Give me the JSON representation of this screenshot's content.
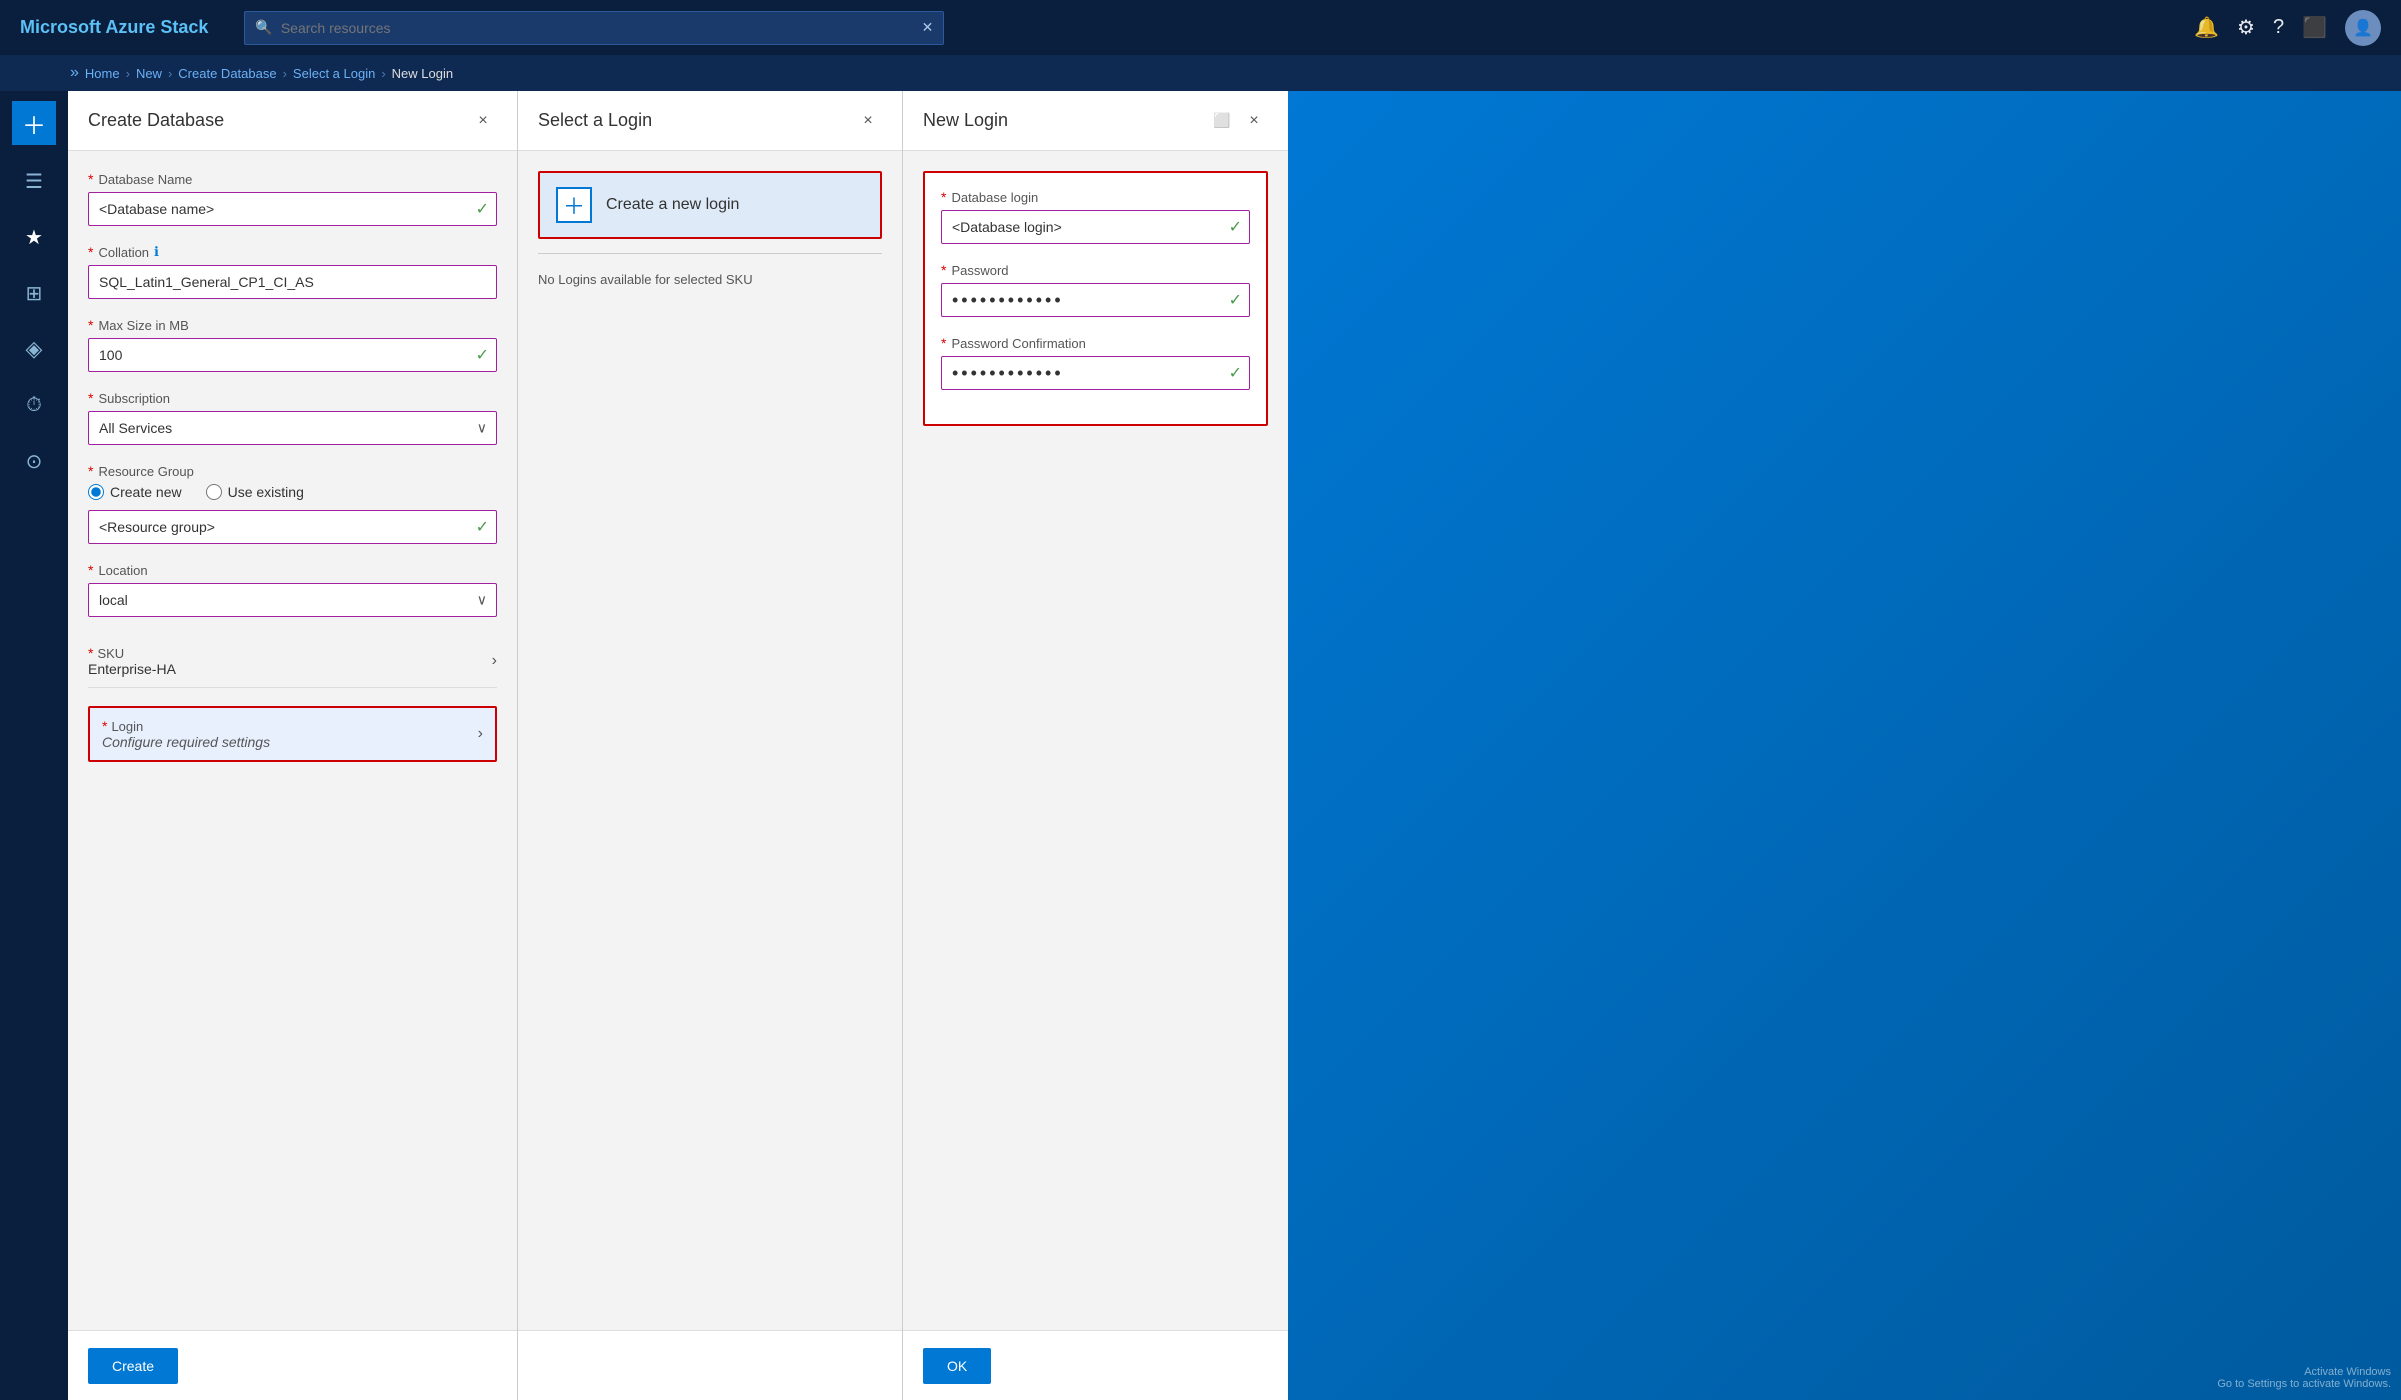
{
  "app": {
    "title": "Microsoft Azure Stack"
  },
  "topbar": {
    "title": "Microsoft Azure Stack",
    "search_placeholder": "Search resources",
    "close_icon": "✕"
  },
  "breadcrumb": {
    "items": [
      "Home",
      "New",
      "Create Database",
      "Select a Login",
      "New Login"
    ],
    "separator": "›"
  },
  "sidebar": {
    "items": [
      {
        "label": "+",
        "icon": "＋",
        "id": "plus"
      },
      {
        "label": "Menu",
        "icon": "☰",
        "id": "menu"
      },
      {
        "label": "Favorites",
        "icon": "★",
        "id": "favorites"
      },
      {
        "label": "Dashboard",
        "icon": "⊞",
        "id": "dashboard"
      },
      {
        "label": "Resources",
        "icon": "⬡",
        "id": "resources"
      },
      {
        "label": "History",
        "icon": "⏱",
        "id": "history"
      },
      {
        "label": "Notifications",
        "icon": "⊙",
        "id": "notifications"
      }
    ]
  },
  "create_database_panel": {
    "title": "Create Database",
    "close_label": "×",
    "fields": {
      "database_name": {
        "label": "Database Name",
        "value": "<Database name>",
        "placeholder": "<Database name>"
      },
      "collation": {
        "label": "Collation",
        "value": "SQL_Latin1_General_CP1_CI_AS"
      },
      "max_size_mb": {
        "label": "Max Size in MB",
        "value": "100"
      },
      "subscription": {
        "label": "Subscription",
        "value": "All Services",
        "options": [
          "All Services"
        ]
      },
      "resource_group": {
        "label": "Resource Group",
        "radio_create_new": "Create new",
        "radio_use_existing": "Use existing",
        "value": "<Resource group>",
        "placeholder": "<Resource group>"
      },
      "location": {
        "label": "Location",
        "value": "local",
        "options": [
          "local"
        ]
      },
      "sku": {
        "label": "SKU",
        "value": "Enterprise-HA"
      },
      "login": {
        "label": "Login",
        "value": "Configure required settings"
      }
    },
    "create_button": "Create"
  },
  "select_login_panel": {
    "title": "Select a Login",
    "close_label": "×",
    "create_new_login_label": "Create a new login",
    "no_logins_text": "No Logins available for selected SKU"
  },
  "new_login_panel": {
    "title": "New Login",
    "close_label": "×",
    "fields": {
      "database_login": {
        "label": "Database login",
        "value": "<Database login>",
        "placeholder": "<Database login>"
      },
      "password": {
        "label": "Password",
        "value": "••••••••••••"
      },
      "password_confirmation": {
        "label": "Password Confirmation",
        "value": "••••••••••••"
      }
    },
    "ok_button": "OK"
  },
  "windows_activate": "Go to Settings to activate Windows."
}
